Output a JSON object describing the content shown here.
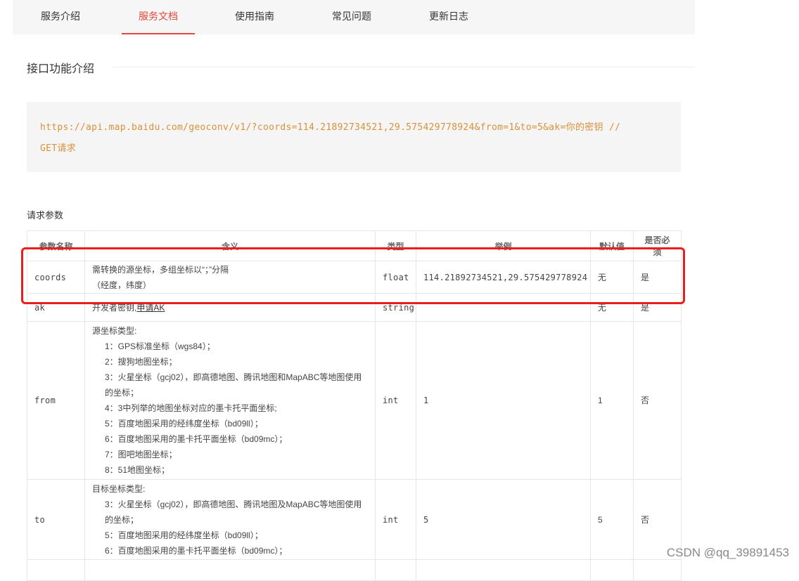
{
  "tabs": [
    {
      "label": "服务介绍",
      "active": false
    },
    {
      "label": "服务文档",
      "active": true
    },
    {
      "label": "使用指南",
      "active": false
    },
    {
      "label": "常见问题",
      "active": false
    },
    {
      "label": "更新日志",
      "active": false
    }
  ],
  "section_title": "接口功能介绍",
  "code": {
    "url": "https://api.map.baidu.com/geoconv/v1/?coords=114.21892734521,29.575429778924&from=1&to=5&ak=你的密钥 //",
    "method": "GET请求"
  },
  "params_title": "请求参数",
  "table": {
    "headers": [
      "参数名称",
      "含义",
      "类型",
      "举例",
      "默认值",
      "是否必须"
    ],
    "rows": {
      "coords": {
        "name": "coords",
        "meaning_line1": "需转换的源坐标，多组坐标以“；”分隔",
        "meaning_line2": "（经度，纬度）",
        "type": "float",
        "example": "114.21892734521,29.575429778924",
        "default": "无",
        "required": "是"
      },
      "ak": {
        "name": "ak",
        "meaning": "开发者密钥,",
        "link": "申请AK",
        "type": "string",
        "example": "",
        "default": "无",
        "required": "是"
      },
      "from": {
        "name": "from",
        "intro": "源坐标类型:",
        "items": [
          "1：GPS标准坐标（wgs84）；",
          "2：搜狗地图坐标；",
          "3：火星坐标（gcj02），即高德地图、腾讯地图和MapABC等地图使用的坐标；",
          "4：3中列举的地图坐标对应的墨卡托平面坐标;",
          "5：百度地图采用的经纬度坐标（bd09ll）；",
          "6：百度地图采用的墨卡托平面坐标（bd09mc）；",
          "7：图吧地图坐标；",
          "8：51地图坐标；"
        ],
        "type": "int",
        "example": "1",
        "default": "1",
        "required": "否"
      },
      "to": {
        "name": "to",
        "intro": "目标坐标类型:",
        "items": [
          "3：火星坐标（gcj02），即高德地图、腾讯地图及MapABC等地图使用的坐标；",
          "5：百度地图采用的经纬度坐标（bd09ll）；",
          "6：百度地图采用的墨卡托平面坐标（bd09mc）；"
        ],
        "type": "int",
        "example": "5",
        "default": "5",
        "required": "否"
      }
    }
  },
  "highlight_color": "#ee1c1c",
  "accent_color": "#e1473c",
  "code_color": "#d9913b",
  "watermark": "CSDN @qq_39891453"
}
